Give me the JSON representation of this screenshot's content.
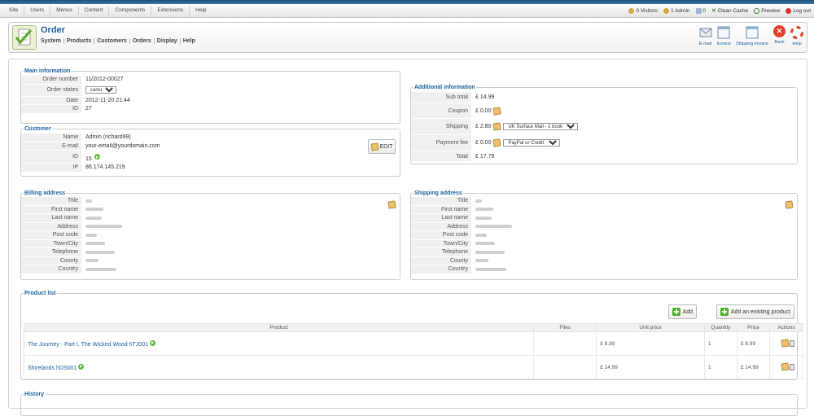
{
  "topmenu": {
    "items": [
      "Site",
      "Users",
      "Menus",
      "Content",
      "Components",
      "Extensions",
      "Help"
    ],
    "status": {
      "visitors": "0 Visitors",
      "admins": "1 Admin",
      "count": "0",
      "clean_cache": "Clean Cache",
      "preview": "Preview",
      "logout": "Log out"
    }
  },
  "header": {
    "title": "Order",
    "submenu": [
      "System",
      "Products",
      "Customers",
      "Orders",
      "Display",
      "Help"
    ],
    "toolbar": [
      "E-mail",
      "Invoice",
      "Shipping invoice",
      "Back",
      "Help"
    ]
  },
  "main_info": {
    "legend": "Main information",
    "order_number_label": "Order number",
    "order_number": "11/2012-00027",
    "order_states_label": "Order states",
    "order_state": "cancelled",
    "date_label": "Date",
    "date": "2012-11-20 21:44",
    "id_label": "ID",
    "id": "27"
  },
  "customer": {
    "legend": "Customer",
    "name_label": "Name",
    "name": "Admin (richard99)",
    "email_label": "E-mail",
    "email": "your-email@yourdomain.com",
    "id_label": "ID",
    "id": "15",
    "ip_label": "IP",
    "ip": "86.174.145.219",
    "edit_label": "EDIT"
  },
  "additional": {
    "legend": "Additional information",
    "subtotal_label": "Sub total",
    "subtotal": "£ 14.99",
    "coupon_label": "Coupon",
    "coupon": "£ 0.00",
    "shipping_label": "Shipping",
    "shipping": "£ 2.80",
    "shipping_method": "UK Surface Mail - 1 book",
    "payment_label": "Payment fee",
    "payment": "£ 0.00",
    "payment_method": "PayPal or Credit Card",
    "total_label": "Total",
    "total": "£ 17.79"
  },
  "billing": {
    "legend": "Billing address",
    "labels": [
      "Title",
      "First name",
      "Last name",
      "Address",
      "Post code",
      "Town/City",
      "Telephone",
      "County",
      "Country"
    ]
  },
  "shipping_address": {
    "legend": "Shipping address",
    "labels": [
      "Title",
      "First name",
      "Last name",
      "Address",
      "Post code",
      "Town/City",
      "Telephone",
      "County",
      "Country"
    ]
  },
  "product_list": {
    "legend": "Product list",
    "add_label": "Add",
    "add_existing_label": "Add an existing product",
    "columns": [
      "Product",
      "Files",
      "Unit price",
      "Quantity",
      "Price",
      "Actions"
    ],
    "rows": [
      {
        "product": "The Journey - Part I, The Wicked Wood hTJ001",
        "unit_price": "£ 8.99",
        "quantity": "1",
        "price": "£ 8.99"
      },
      {
        "product": "Shirelands hDS001",
        "unit_price": "£ 14.99",
        "quantity": "1",
        "price": "£ 14.99"
      }
    ]
  },
  "history": {
    "legend": "History"
  }
}
